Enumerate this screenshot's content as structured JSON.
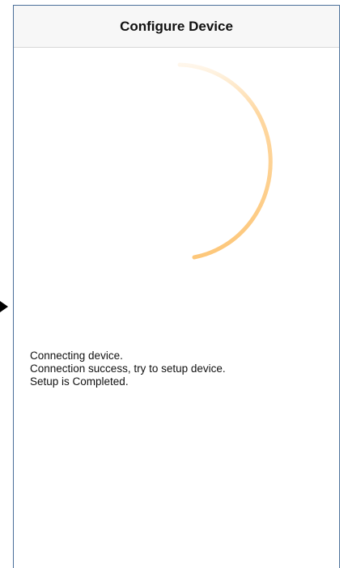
{
  "header": {
    "title": "Configure Device"
  },
  "spinner": {
    "name": "loading-spinner",
    "color": "#fdc77a"
  },
  "status": {
    "lines": [
      "Connecting device.",
      "Connection success, try to setup device.",
      "Setup is Completed."
    ]
  },
  "icons": {
    "side_arrow": "arrow-right-icon"
  }
}
